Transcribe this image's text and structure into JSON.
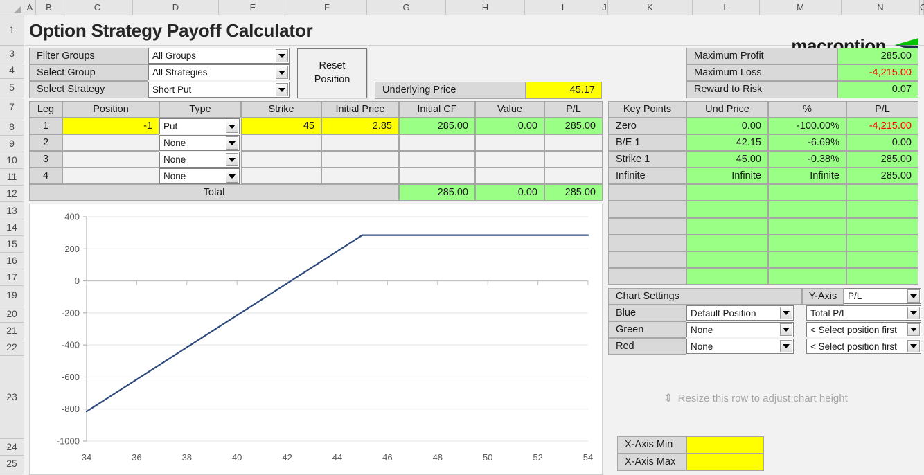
{
  "app": {
    "title": "Option Strategy Payoff Calculator",
    "brand": "macroption"
  },
  "grid": {
    "columns": [
      "A",
      "B",
      "C",
      "D",
      "E",
      "F",
      "G",
      "H",
      "I",
      "J",
      "K",
      "L",
      "M",
      "N",
      "O"
    ],
    "rows": [
      "1",
      "3",
      "4",
      "5",
      "7",
      "8",
      "9",
      "10",
      "11",
      "12",
      "13",
      "14",
      "15",
      "16",
      "17",
      "19",
      "20",
      "21",
      "22",
      "23",
      "24",
      "25"
    ]
  },
  "selectors": {
    "filter_groups_label": "Filter Groups",
    "filter_groups_value": "All Groups",
    "select_group_label": "Select Group",
    "select_group_value": "All Strategies",
    "select_strategy_label": "Select Strategy",
    "select_strategy_value": "Short Put",
    "reset_button": "Reset\nPosition",
    "reset_button_line1": "Reset",
    "reset_button_line2": "Position"
  },
  "underlying": {
    "label": "Underlying Price",
    "value": "45.17"
  },
  "summary": {
    "rows": [
      {
        "label": "Maximum Profit",
        "value": "285.00",
        "negative": false
      },
      {
        "label": "Maximum Loss",
        "value": "-4,215.00",
        "negative": true
      },
      {
        "label": "Reward to Risk",
        "value": "0.07",
        "negative": false
      }
    ]
  },
  "legs": {
    "headers": [
      "Leg",
      "Position",
      "Type",
      "Strike",
      "Initial Price",
      "Initial CF",
      "Value",
      "P/L"
    ],
    "rows": [
      {
        "leg": "1",
        "position": "-1",
        "type": "Put",
        "strike": "45",
        "initial_price": "2.85",
        "initial_cf": "285.00",
        "value": "0.00",
        "pl": "285.00",
        "active": true
      },
      {
        "leg": "2",
        "position": "",
        "type": "None",
        "strike": "",
        "initial_price": "",
        "initial_cf": "",
        "value": "",
        "pl": "",
        "active": false
      },
      {
        "leg": "3",
        "position": "",
        "type": "None",
        "strike": "",
        "initial_price": "",
        "initial_cf": "",
        "value": "",
        "pl": "",
        "active": false
      },
      {
        "leg": "4",
        "position": "",
        "type": "None",
        "strike": "",
        "initial_price": "",
        "initial_cf": "",
        "value": "",
        "pl": "",
        "active": false
      }
    ],
    "total_label": "Total",
    "total_initial_cf": "285.00",
    "total_value": "0.00",
    "total_pl": "285.00"
  },
  "key_points": {
    "headers": [
      "Key Points",
      "Und Price",
      "%",
      "P/L"
    ],
    "rows": [
      {
        "name": "Zero",
        "und_price": "0.00",
        "pct": "-100.00%",
        "pl": "-4,215.00",
        "pl_negative": true
      },
      {
        "name": "B/E 1",
        "und_price": "42.15",
        "pct": "-6.69%",
        "pl": "0.00",
        "pl_negative": false
      },
      {
        "name": "Strike 1",
        "und_price": "45.00",
        "pct": "-0.38%",
        "pl": "285.00",
        "pl_negative": false
      },
      {
        "name": "Infinite",
        "und_price": "Infinite",
        "pct": "Infinite",
        "pl": "285.00",
        "pl_negative": false
      },
      {
        "name": "",
        "und_price": "",
        "pct": "",
        "pl": "",
        "pl_negative": false
      },
      {
        "name": "",
        "und_price": "",
        "pct": "",
        "pl": "",
        "pl_negative": false
      },
      {
        "name": "",
        "und_price": "",
        "pct": "",
        "pl": "",
        "pl_negative": false
      },
      {
        "name": "",
        "und_price": "",
        "pct": "",
        "pl": "",
        "pl_negative": false
      },
      {
        "name": "",
        "und_price": "",
        "pct": "",
        "pl": "",
        "pl_negative": false
      },
      {
        "name": "",
        "und_price": "",
        "pct": "",
        "pl": "",
        "pl_negative": false
      }
    ]
  },
  "chart_settings": {
    "title": "Chart Settings",
    "y_axis_label": "Y-Axis",
    "y_axis_value": "P/L",
    "series": [
      {
        "color_label": "Blue",
        "position": "Default Position",
        "metric": "Total P/L"
      },
      {
        "color_label": "Green",
        "position": "None",
        "metric": "< Select position first"
      },
      {
        "color_label": "Red",
        "position": "None",
        "metric": "< Select position first"
      }
    ]
  },
  "resize_hint": "Resize this row to adjust chart height",
  "x_axis": {
    "min_label": "X-Axis Min",
    "min_value": "",
    "max_label": "X-Axis Max",
    "max_value": ""
  },
  "chart_data": {
    "type": "line",
    "title": "",
    "xlabel": "",
    "ylabel": "",
    "xlim": [
      34,
      54
    ],
    "ylim": [
      -1000,
      400
    ],
    "xticks": [
      34,
      36,
      38,
      40,
      42,
      44,
      46,
      48,
      50,
      52,
      54
    ],
    "yticks": [
      -1000,
      -800,
      -600,
      -400,
      -200,
      0,
      200,
      400
    ],
    "grid": true,
    "legend": false,
    "line_color": "#2E4A7D",
    "series": [
      {
        "name": "Total P/L",
        "x": [
          34,
          36,
          38,
          40,
          42,
          42.15,
          44,
          45,
          46,
          48,
          50,
          52,
          54
        ],
        "y": [
          -815,
          -615,
          -415,
          -215,
          -15,
          0,
          185,
          285,
          285,
          285,
          285,
          285,
          285
        ]
      }
    ]
  },
  "colors": {
    "green_fill": "#99FF85",
    "yellow_fill": "#FFFF00",
    "grey_label": "#D9D9D9",
    "negative_text": "#FF0000",
    "chart_line": "#2E4A7D",
    "logo_green": "#00C000",
    "logo_navy": "#1F2B4D"
  }
}
